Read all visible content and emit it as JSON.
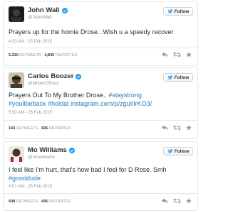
{
  "tweets": [
    {
      "name": "John Wall",
      "handle": "@JohnWall",
      "follow_label": "Follow",
      "text": "Prayers up for the homie Drose...Wish u a speedy recover",
      "timestamp": "4:53 AM - 25 Feb 2015",
      "retweets": "5,210",
      "retweets_label": "RETWEETS",
      "favorites": "4,835",
      "favorites_label": "FAVORITES",
      "avatar_icon": "john-wall-avatar"
    },
    {
      "name": "Carlos Boozer",
      "handle": "@MisterCBooz",
      "follow_label": "Follow",
      "text_line1": "Prayers Out To My Brother Drose..",
      "text_tag1": "#staystrong",
      "text_tag2": "#youllbeback",
      "text_tag3": "#holdat",
      "text_link": "instagram.com/p/zguIlIrKO3/",
      "timestamp": "5:50 AM - 25 Feb 2015",
      "retweets": "143",
      "retweets_label": "RETWEETS",
      "favorites": "196",
      "favorites_label": "FAVORITES",
      "avatar_icon": "carlos-boozer-avatar"
    },
    {
      "name": "Mo Williams",
      "handle": "@mowilliams",
      "follow_label": "Follow",
      "text": "I feel like I'm hurt,  that's how bad I feel for D Rose.  Smh",
      "text_tag": "#gooddude",
      "timestamp": "4:51 AM - 25 Feb 2015",
      "retweets": "508",
      "retweets_label": "RETWEETS",
      "favorites": "436",
      "favorites_label": "FAVORITES",
      "avatar_icon": "mo-williams-avatar"
    }
  ],
  "colors": {
    "link": "#2b7bb9",
    "verified": "#1da1f2",
    "muted": "#8899a6",
    "border": "#e1e8ed"
  },
  "icons": [
    "verified-icon",
    "twitter-bird-icon",
    "reply-icon",
    "retweet-icon",
    "favorite-icon"
  ]
}
